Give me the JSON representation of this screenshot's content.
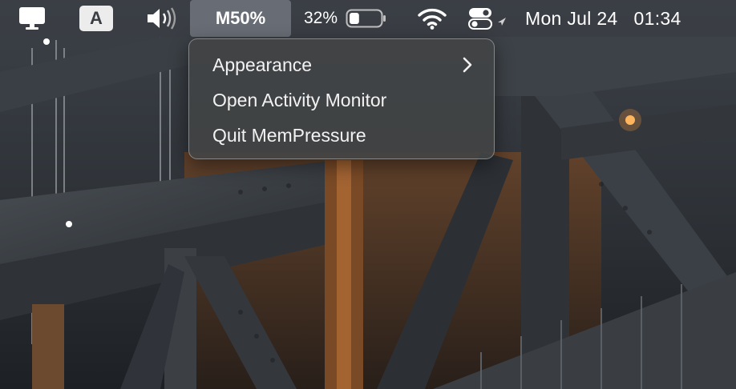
{
  "menubar": {
    "icons": {
      "display": "display-icon",
      "input": "input-source-icon",
      "volume": "volume-icon",
      "battery": "battery-icon",
      "wifi": "wifi-icon",
      "control_center": "control-center-icon",
      "location": "location-arrow-icon"
    },
    "input_source_label": "A",
    "mempressure_label": "M50%",
    "battery_percent": "32%",
    "battery_level": 0.32,
    "clock": {
      "date": "Mon Jul 24",
      "time": "01:34"
    }
  },
  "dropdown": {
    "items": [
      {
        "label": "Appearance",
        "has_submenu": true
      },
      {
        "label": "Open Activity Monitor",
        "has_submenu": false
      },
      {
        "label": "Quit MemPressure",
        "has_submenu": false
      }
    ]
  },
  "colors": {
    "menubar_bg": "#3a3e44",
    "menu_text": "#f2f2f2",
    "highlight": "#787e86"
  }
}
